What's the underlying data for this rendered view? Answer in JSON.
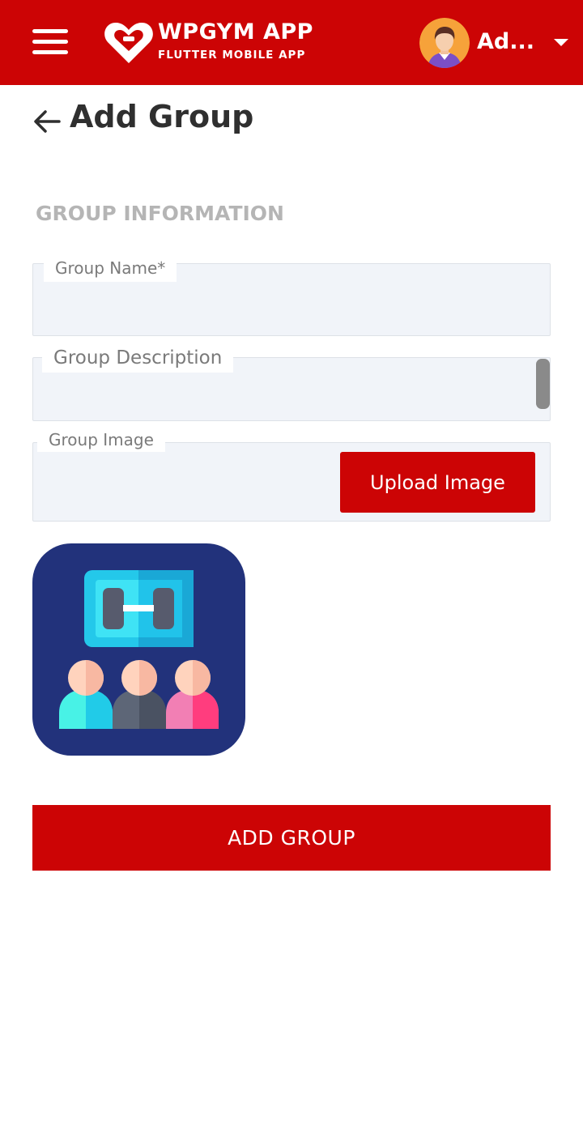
{
  "header": {
    "menu_icon": "hamburger-menu-icon",
    "logo_icon": "heart-dumbbell-logo-icon",
    "brand_title": "WPGYM APP",
    "brand_subtitle": "FLUTTER MOBILE APP",
    "user_name": "Ad...",
    "user_menu_icon": "caret-down-icon",
    "colors": {
      "bar": "#cc0405",
      "text": "#ffffff"
    }
  },
  "page": {
    "back_icon": "arrow-left-icon",
    "title": "Add Group"
  },
  "form": {
    "section_heading": "GROUP INFORMATION",
    "group_name": {
      "label": "Group Name*",
      "value": ""
    },
    "group_description": {
      "label": "Group Description",
      "value": ""
    },
    "group_image": {
      "label": "Group Image",
      "upload_label": "Upload Image",
      "preview_icon": "group-training-icon"
    },
    "submit_label": "ADD GROUP",
    "colors": {
      "field_bg": "#f1f4f9",
      "accent": "#cc0405"
    }
  }
}
